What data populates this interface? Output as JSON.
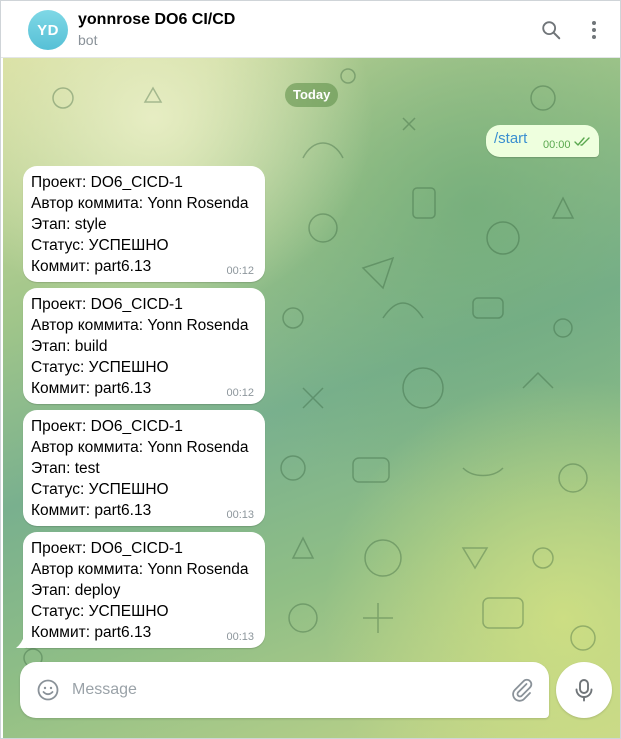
{
  "header": {
    "avatar_initials": "YD",
    "title": "yonnrose DO6 CI/CD",
    "subtitle": "bot",
    "icons": [
      "search-icon",
      "more-vertical-icon"
    ]
  },
  "chat": {
    "date_badge": "Today",
    "outgoing": {
      "text": "/start",
      "time": "00:00",
      "status": "read"
    },
    "messages": [
      {
        "lines": [
          "Проект: DO6_CICD-1",
          "Автор коммита: Yonn Rosenda",
          "Этап: style",
          "Статус: УСПЕШНО",
          "Коммит: part6.13"
        ],
        "time": "00:12"
      },
      {
        "lines": [
          "Проект: DO6_CICD-1",
          "Автор коммита: Yonn Rosenda",
          "Этап: build",
          "Статус: УСПЕШНО",
          "Коммит: part6.13"
        ],
        "time": "00:12"
      },
      {
        "lines": [
          "Проект: DO6_CICD-1",
          "Автор коммита: Yonn Rosenda",
          "Этап: test",
          "Статус: УСПЕШНО",
          "Коммит: part6.13"
        ],
        "time": "00:13"
      },
      {
        "lines": [
          "Проект: DO6_CICD-1",
          "Автор коммита: Yonn Rosenda",
          "Этап: deploy",
          "Статус: УСПЕШНО",
          "Коммит: part6.13"
        ],
        "time": "00:13"
      }
    ]
  },
  "composer": {
    "placeholder": "Message",
    "icons": [
      "emoji-icon",
      "attach-icon",
      "microphone-icon"
    ]
  },
  "colors": {
    "accent": "#3a8fd0",
    "outgoing_bubble": "#eeffde",
    "read_check": "#5aa84f",
    "avatar": "#56c0d6"
  }
}
